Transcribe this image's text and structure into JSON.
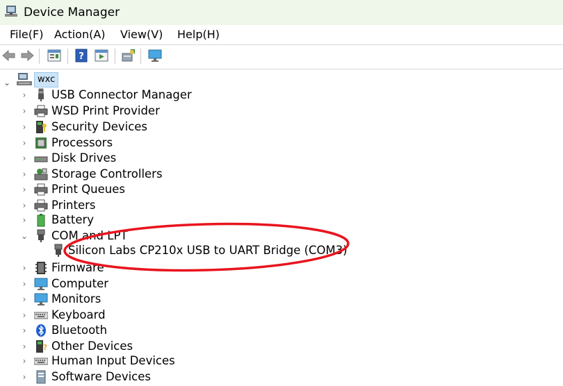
{
  "window": {
    "title": "Device Manager",
    "icon": "device-manager-icon"
  },
  "menu": [
    {
      "label": "File(F)"
    },
    {
      "label": "Action(A)"
    },
    {
      "label": "View(V)"
    },
    {
      "label": "Help(H)"
    }
  ],
  "toolbar": {
    "buttons": [
      "back-arrow-icon",
      "forward-arrow-icon",
      "properties-icon",
      "help-icon",
      "update-driver-icon",
      "scan-hardware-icon",
      "monitor-icon"
    ]
  },
  "tree": {
    "root": {
      "label": "wxc",
      "expanded": true,
      "icon": "computer-network-icon"
    },
    "items": [
      {
        "label": "USB Connector Manager",
        "icon": "usb-icon",
        "expanded": false
      },
      {
        "label": "WSD Print Provider",
        "icon": "printer-icon",
        "expanded": false
      },
      {
        "label": "Security Devices",
        "icon": "security-device-icon",
        "expanded": false
      },
      {
        "label": "Processors",
        "icon": "processor-icon",
        "expanded": false
      },
      {
        "label": "Disk Drives",
        "icon": "disk-drive-icon",
        "expanded": false
      },
      {
        "label": "Storage Controllers",
        "icon": "storage-controller-icon",
        "expanded": false
      },
      {
        "label": "Print Queues",
        "icon": "print-queue-icon",
        "expanded": false
      },
      {
        "label": "Printers",
        "icon": "printer-icon",
        "expanded": false
      },
      {
        "label": "Battery",
        "icon": "battery-icon",
        "expanded": false
      },
      {
        "label": "COM and LPT",
        "icon": "port-icon",
        "expanded": true,
        "children": [
          {
            "label": "Silicon Labs CP210x USB to UART Bridge (COM3)",
            "icon": "port-device-icon"
          }
        ]
      },
      {
        "label": "Firmware",
        "icon": "firmware-icon",
        "expanded": false
      },
      {
        "label": "Computer",
        "icon": "computer-icon",
        "expanded": false
      },
      {
        "label": "Monitors",
        "icon": "monitor-icon",
        "expanded": false
      },
      {
        "label": "Keyboard",
        "icon": "keyboard-icon",
        "expanded": false
      },
      {
        "label": "Bluetooth",
        "icon": "bluetooth-icon",
        "expanded": false
      },
      {
        "label": "Other Devices",
        "icon": "other-devices-icon",
        "expanded": false
      },
      {
        "label": "Human Input Devices",
        "icon": "hid-icon",
        "expanded": false
      },
      {
        "label": "Software Devices",
        "icon": "software-device-icon",
        "expanded": false
      }
    ]
  },
  "annotation": {
    "color": "#e8141e",
    "shape": "ellipse",
    "target": "Silicon Labs CP210x USB to UART Bridge (COM3)"
  },
  "colors": {
    "title_bar": "#eef7ea",
    "selection": "#cce4f7",
    "selection_border": "#99c9ef"
  }
}
